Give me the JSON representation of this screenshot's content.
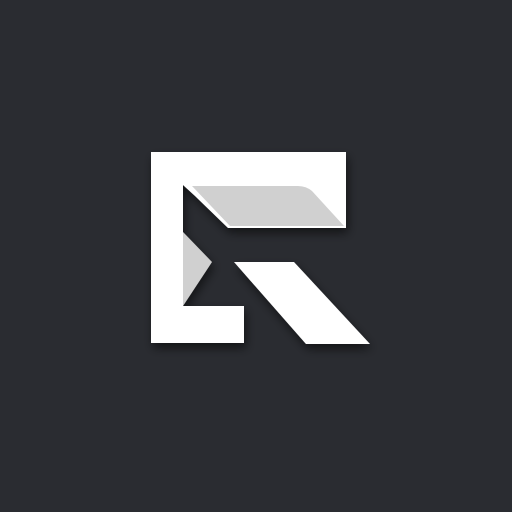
{
  "app": {
    "icon": "r-logo-icon",
    "colors": {
      "background": "#2a2c31",
      "primary": "#ffffff",
      "secondary": "#d0d0d0",
      "shadow": "#000000"
    }
  }
}
